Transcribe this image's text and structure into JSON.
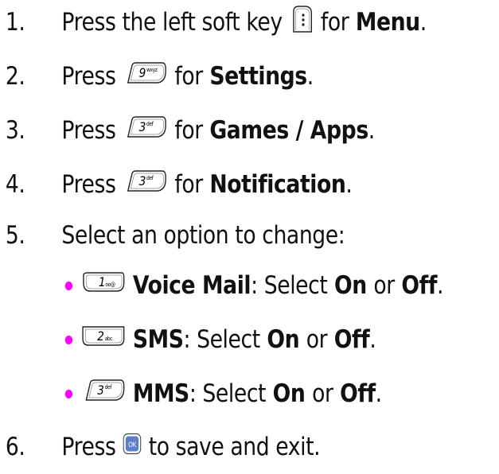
{
  "steps": [
    {
      "number": "1.",
      "before": "Press the left soft key",
      "after": "for",
      "bold": "Menu",
      "end": ".",
      "key": "left-soft-key"
    },
    {
      "number": "2.",
      "before": "Press",
      "after": "for",
      "bold": "Settings",
      "end": ".",
      "key": "9",
      "key_label": "9",
      "key_sub": "wxyz"
    },
    {
      "number": "3.",
      "before": "Press",
      "after": "for",
      "bold": "Games / Apps",
      "end": ".",
      "key": "3",
      "key_label": "3",
      "key_sub": "def"
    },
    {
      "number": "4.",
      "before": "Press",
      "after": "for",
      "bold": "Notification",
      "end": ".",
      "key": "3",
      "key_label": "3",
      "key_sub": "def"
    },
    {
      "number": "5.",
      "text": "Select an option to change:"
    },
    {
      "number": "6.",
      "before": "Press",
      "after": "to save and exit.",
      "key": "ok",
      "key_label": "OK"
    }
  ],
  "options": [
    {
      "key_label": "1",
      "key_sub": "oo@",
      "name": "Voice Mail",
      "text": ": Select",
      "on": "On",
      "or": "or",
      "off": "Off",
      "end": "."
    },
    {
      "key_label": "2",
      "key_sub": "abc",
      "name": "SMS",
      "text": ": Select",
      "on": "On",
      "or": "or",
      "off": "Off",
      "end": "."
    },
    {
      "key_label": "3",
      "key_sub": "def",
      "name": "MMS",
      "text": ": Select",
      "on": "On",
      "or": "or",
      "off": "Off",
      "end": "."
    }
  ],
  "colors": {
    "bullet": "#ff00ff",
    "ok_key": "#5a7fc8",
    "text": "#111111"
  }
}
